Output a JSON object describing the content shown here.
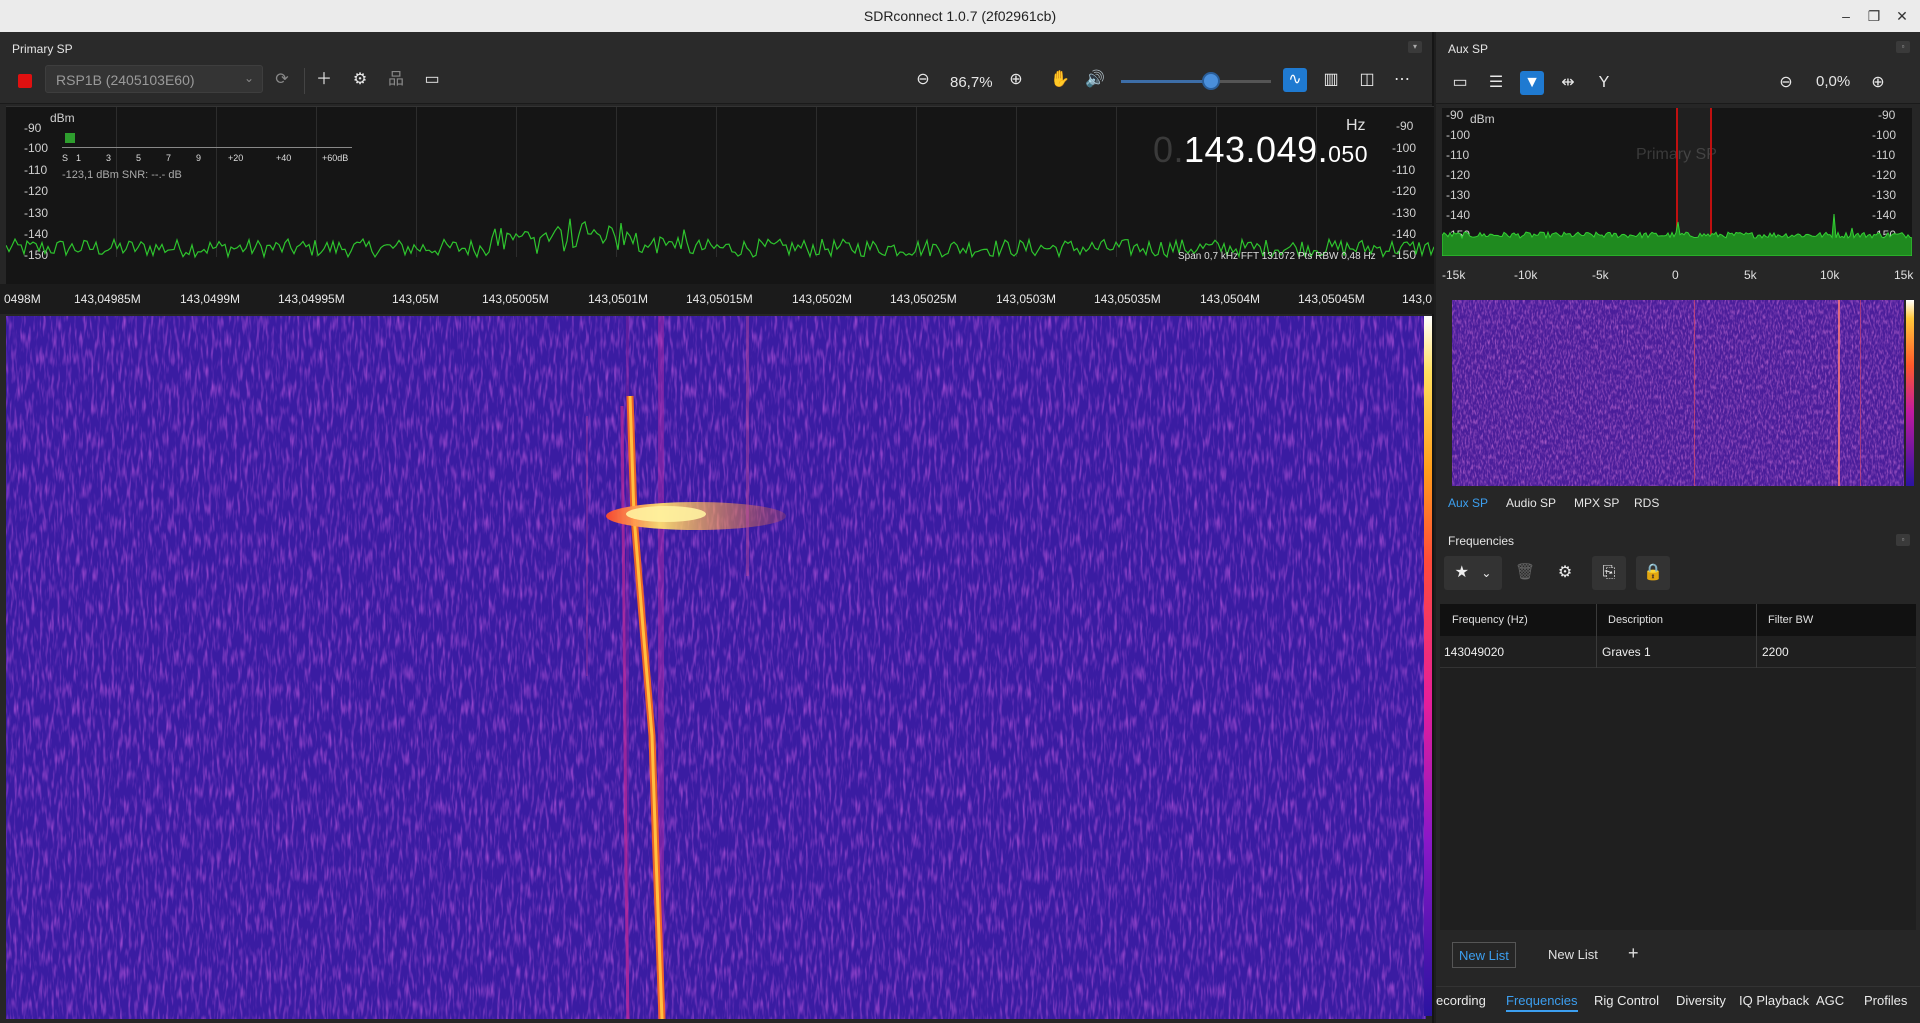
{
  "window": {
    "title": "SDRconnect 1.0.7 (2f02961cb)",
    "minimize": "–",
    "restore": "❐",
    "close": "✕"
  },
  "primary": {
    "panel_title": "Primary SP",
    "device": "RSP1B (2405103E60)",
    "zoom": "86,7%",
    "volume_level": 0.6,
    "spectrum": {
      "unit": "dBm",
      "db_ticks": [
        "-90",
        "-100",
        "-110",
        "-120",
        "-130",
        "-140",
        "-150"
      ],
      "meter_ticks": [
        "S",
        "1",
        "3",
        "5",
        "7",
        "9",
        "+20",
        "+40",
        "+60dB"
      ],
      "meter_readout": "-123,1 dBm   SNR:  --.- dB",
      "hz_label": "Hz",
      "freq_ghost": "0.",
      "freq_main": "143.049.",
      "freq_small": "050",
      "span_info": "Span 0,7 kHz  FFT 131072 Pts  RBW 0,48 Hz"
    },
    "freq_axis": [
      "0498M",
      "143,04985M",
      "143,0499M",
      "143,04995M",
      "143,05M",
      "143,05005M",
      "143,0501M",
      "143,05015M",
      "143,0502M",
      "143,05025M",
      "143,0503M",
      "143,05035M",
      "143,0504M",
      "143,05045M",
      "143,0"
    ]
  },
  "aux": {
    "panel_title": "Aux SP",
    "zoom": "0,0%",
    "unit": "dBm",
    "db_ticks": [
      "-90",
      "-100",
      "-110",
      "-120",
      "-130",
      "-140",
      "-150"
    ],
    "watermark": "Primary SP",
    "freq_axis": [
      "-15k",
      "-10k",
      "-5k",
      "0",
      "5k",
      "10k",
      "15k"
    ],
    "tabs": [
      "Aux SP",
      "Audio SP",
      "MPX SP",
      "RDS"
    ]
  },
  "frequencies": {
    "panel_title": "Frequencies",
    "columns": [
      "Frequency (Hz)",
      "Description",
      "Filter BW"
    ],
    "rows": [
      {
        "freq": "143049020",
        "desc": "Graves 1",
        "bw": "2200"
      }
    ],
    "lists": [
      "New List",
      "New List"
    ],
    "add_list": "+"
  },
  "bottom_tabs": [
    "ecording",
    "Frequencies",
    "Rig Control",
    "Diversity",
    "IQ Playback",
    "AGC",
    "Profiles"
  ],
  "colors": {
    "accent": "#1f7ad1",
    "trace": "#2ec42e",
    "waterfall_bg": "#3a1a9e",
    "stop": "#e01010"
  }
}
